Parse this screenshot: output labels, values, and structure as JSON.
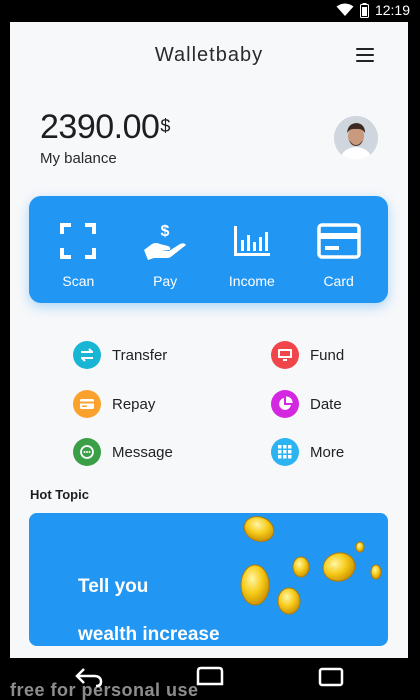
{
  "status_bar": {
    "time": "12:19"
  },
  "header": {
    "title": "Walletbaby"
  },
  "balance": {
    "amount": "2390.00",
    "currency": "$",
    "label": "My balance"
  },
  "actions": [
    {
      "label": "Scan",
      "icon": "scan-icon"
    },
    {
      "label": "Pay",
      "icon": "pay-icon"
    },
    {
      "label": "Income",
      "icon": "income-icon"
    },
    {
      "label": "Card",
      "icon": "card-icon"
    }
  ],
  "features": [
    {
      "label": "Transfer",
      "icon": "transfer-icon",
      "color": "#18b6d4"
    },
    {
      "label": "Fund",
      "icon": "monitor-icon",
      "color": "#f0454a"
    },
    {
      "label": "Repay",
      "icon": "card-icon",
      "color": "#fba12e"
    },
    {
      "label": "Date",
      "icon": "pie-chart-icon",
      "color": "#d327e0"
    },
    {
      "label": "Message",
      "icon": "chat-icon",
      "color": "#3a9f46"
    },
    {
      "label": "More",
      "icon": "grid-icon",
      "color": "#2bb3f2"
    }
  ],
  "hot_topic": {
    "label": "Hot Topic",
    "banner_line1": "Tell you",
    "banner_line2": "wealth increase"
  },
  "watermark": "free for personal use",
  "colors": {
    "primary": "#2196f3",
    "background": "#f7f8fa"
  }
}
